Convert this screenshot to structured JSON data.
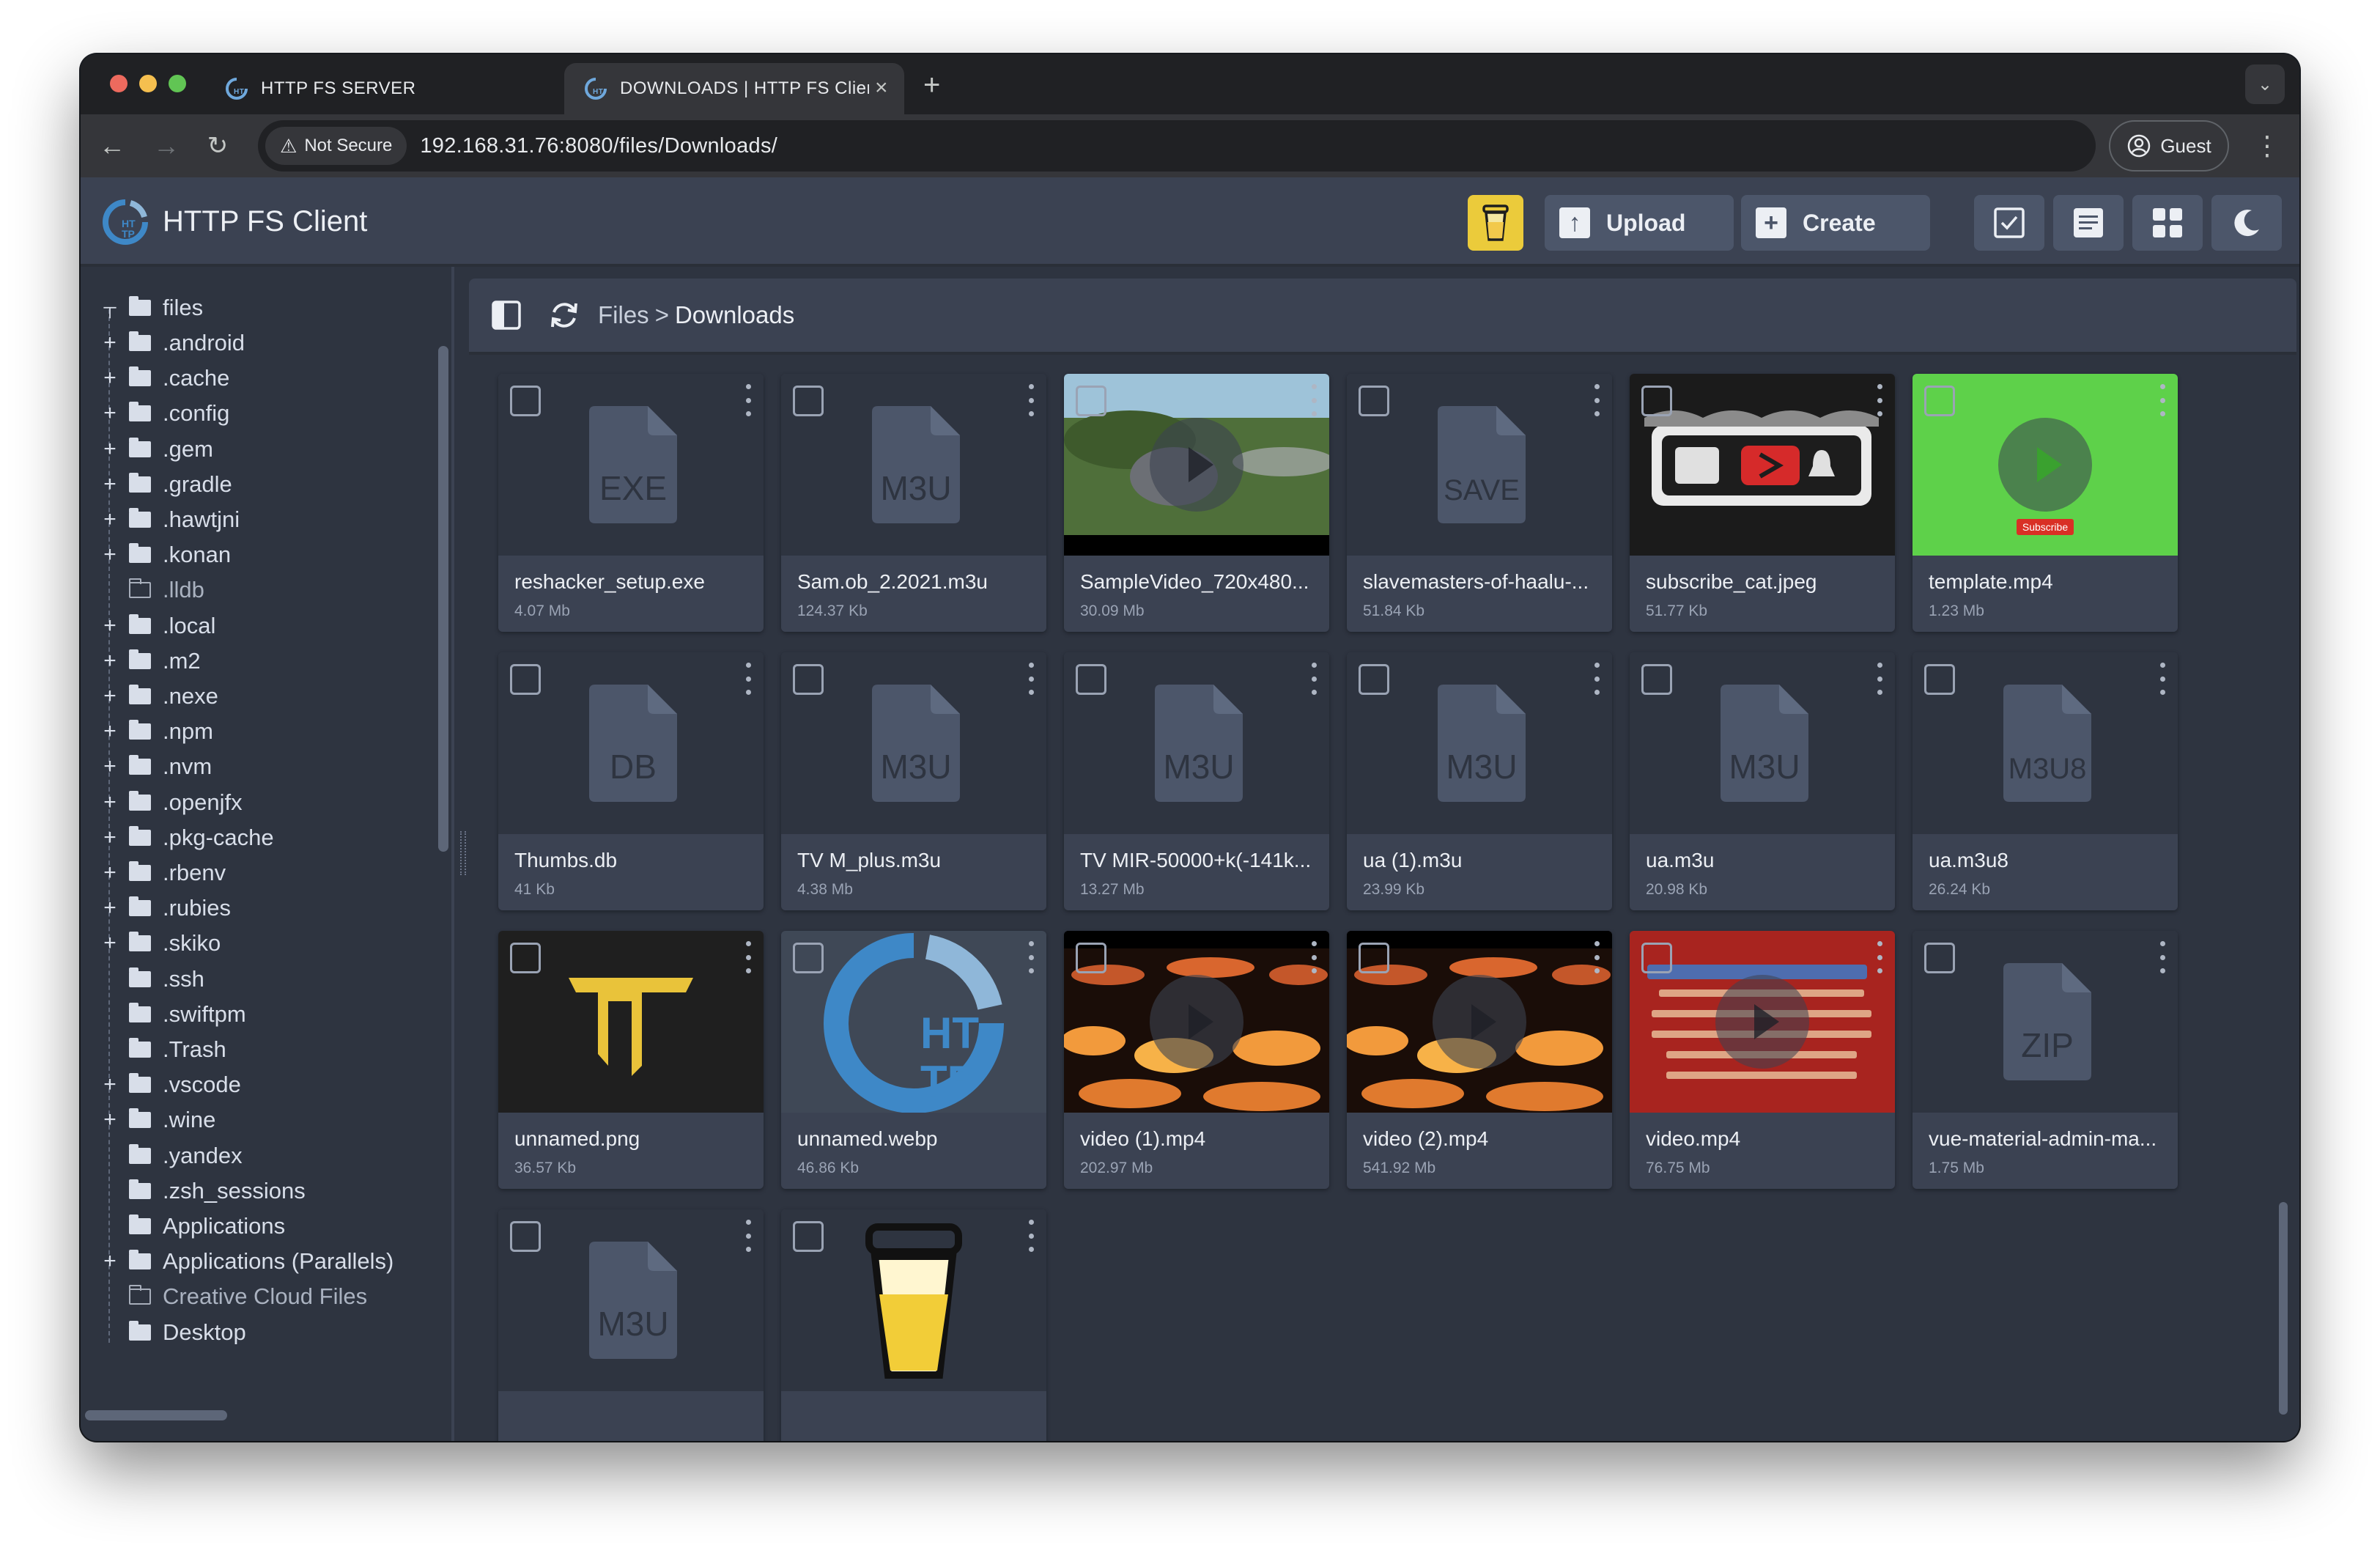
{
  "browser": {
    "tabs": [
      {
        "title": "HTTP FS SERVER",
        "active": false
      },
      {
        "title": "DOWNLOADS | HTTP FS Clier",
        "active": true
      }
    ],
    "security_label": "Not Secure",
    "url": "192.168.31.76:8080/files/Downloads/",
    "profile_label": "Guest"
  },
  "app": {
    "title": "HTTP FS Client",
    "upload_label": "Upload",
    "create_label": "Create"
  },
  "breadcrumb": {
    "root": "Files",
    "separator": ">",
    "current": "Downloads"
  },
  "sidebar": {
    "root": "files",
    "items": [
      {
        "label": ".android",
        "expandable": true,
        "filled": true
      },
      {
        "label": ".cache",
        "expandable": true,
        "filled": true
      },
      {
        "label": ".config",
        "expandable": true,
        "filled": true
      },
      {
        "label": ".gem",
        "expandable": true,
        "filled": true
      },
      {
        "label": ".gradle",
        "expandable": true,
        "filled": true
      },
      {
        "label": ".hawtjni",
        "expandable": true,
        "filled": true
      },
      {
        "label": ".konan",
        "expandable": true,
        "filled": true
      },
      {
        "label": ".lldb",
        "expandable": false,
        "filled": false
      },
      {
        "label": ".local",
        "expandable": true,
        "filled": true
      },
      {
        "label": ".m2",
        "expandable": true,
        "filled": true
      },
      {
        "label": ".nexe",
        "expandable": true,
        "filled": true
      },
      {
        "label": ".npm",
        "expandable": true,
        "filled": true
      },
      {
        "label": ".nvm",
        "expandable": true,
        "filled": true
      },
      {
        "label": ".openjfx",
        "expandable": true,
        "filled": true
      },
      {
        "label": ".pkg-cache",
        "expandable": true,
        "filled": true
      },
      {
        "label": ".rbenv",
        "expandable": true,
        "filled": true
      },
      {
        "label": ".rubies",
        "expandable": true,
        "filled": true
      },
      {
        "label": ".skiko",
        "expandable": true,
        "filled": true
      },
      {
        "label": ".ssh",
        "expandable": false,
        "filled": true
      },
      {
        "label": ".swiftpm",
        "expandable": false,
        "filled": true
      },
      {
        "label": ".Trash",
        "expandable": false,
        "filled": true
      },
      {
        "label": ".vscode",
        "expandable": true,
        "filled": true
      },
      {
        "label": ".wine",
        "expandable": true,
        "filled": true
      },
      {
        "label": ".yandex",
        "expandable": false,
        "filled": true
      },
      {
        "label": ".zsh_sessions",
        "expandable": false,
        "filled": true
      },
      {
        "label": "Applications",
        "expandable": false,
        "filled": true
      },
      {
        "label": "Applications (Parallels)",
        "expandable": true,
        "filled": true
      },
      {
        "label": "Creative Cloud Files",
        "expandable": false,
        "filled": false
      },
      {
        "label": "Desktop",
        "expandable": false,
        "filled": true
      }
    ],
    "status": "online"
  },
  "files": [
    {
      "name": "reshacker_setup.exe",
      "size": "4.07 Mb",
      "thumb": "doc",
      "ext": "EXE"
    },
    {
      "name": "Sam.ob_2.2021.m3u",
      "size": "124.37 Kb",
      "thumb": "doc",
      "ext": "M3U"
    },
    {
      "name": "SampleVideo_720x480...",
      "size": "30.09 Mb",
      "thumb": "video-bunny"
    },
    {
      "name": "slavemasters-of-haalu-...",
      "size": "51.84 Kb",
      "thumb": "doc",
      "ext": "SAVE"
    },
    {
      "name": "subscribe_cat.jpeg",
      "size": "51.77 Kb",
      "thumb": "image-subscribe"
    },
    {
      "name": "template.mp4",
      "size": "1.23 Mb",
      "thumb": "video-green",
      "overlay": "Subscribe"
    },
    {
      "name": "Thumbs.db",
      "size": "41 Kb",
      "thumb": "doc",
      "ext": "DB"
    },
    {
      "name": "TV M_plus.m3u",
      "size": "4.38 Mb",
      "thumb": "doc",
      "ext": "M3U"
    },
    {
      "name": "TV MIR-50000+k(-141k...",
      "size": "13.27 Mb",
      "thumb": "doc",
      "ext": "M3U"
    },
    {
      "name": "ua (1).m3u",
      "size": "23.99 Kb",
      "thumb": "doc",
      "ext": "M3U"
    },
    {
      "name": "ua.m3u",
      "size": "20.98 Kb",
      "thumb": "doc",
      "ext": "M3U"
    },
    {
      "name": "ua.m3u8",
      "size": "26.24 Kb",
      "thumb": "doc",
      "ext": "M3U8"
    },
    {
      "name": "unnamed.png",
      "size": "36.57 Kb",
      "thumb": "image-logo-t"
    },
    {
      "name": "unnamed.webp",
      "size": "46.86 Kb",
      "thumb": "image-logo-http"
    },
    {
      "name": "video (1).mp4",
      "size": "202.97 Mb",
      "thumb": "video-lights"
    },
    {
      "name": "video (2).mp4",
      "size": "541.92 Mb",
      "thumb": "video-lights"
    },
    {
      "name": "video.mp4",
      "size": "76.75 Mb",
      "thumb": "video-red"
    },
    {
      "name": "vue-material-admin-ma...",
      "size": "1.75 Mb",
      "thumb": "doc",
      "ext": "ZIP"
    },
    {
      "name": "",
      "size": "",
      "thumb": "doc",
      "ext": "M3U"
    },
    {
      "name": "",
      "size": "",
      "thumb": "image-coffee"
    }
  ],
  "colors": {
    "background": "#2e3440",
    "panel": "#3b4252",
    "button": "#4c566a",
    "text": "#eceff4",
    "accent_yellow": "#ebcb3b",
    "logo_blue": "#3e88c7",
    "online_green": "#39b54a"
  }
}
